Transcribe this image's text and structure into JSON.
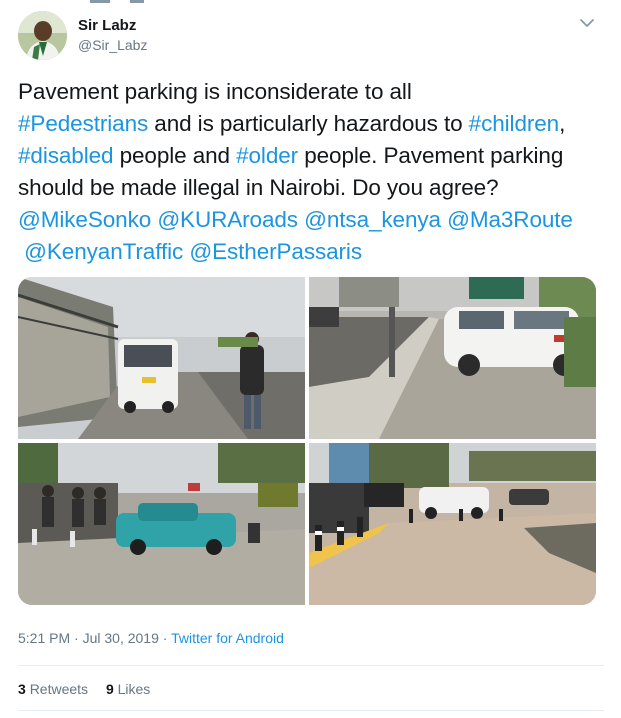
{
  "author": {
    "display_name": "Sir Labz",
    "handle": "@Sir_Labz"
  },
  "tweet": {
    "line1": "Pavement parking is inconsiderate to all",
    "hashtag_pedestrians": "#Pedestrians",
    "line2_mid": " and is particularly hazardous to ",
    "hashtag_children": "#children",
    "line2_end": ",",
    "hashtag_disabled": "#disabled",
    "line3_mid": " people and ",
    "hashtag_older": "#older",
    "line3_end": " people. Pavement parking",
    "line4": "should be made illegal in Nairobi. Do you agree?",
    "mention_mikesonko": "@MikeSonko",
    "mention_kuraroads": "@KURAroads",
    "mention_ntsa": "@ntsa_kenya",
    "mention_ma3route": "@Ma3Route",
    "mention_kenyantraffic": "@KenyanTraffic",
    "mention_estherpassaris": "@EstherPassaris"
  },
  "meta": {
    "timestamp": "5:21 PM · Jul 30, 2019",
    "separator": " · ",
    "source": "Twitter for Android"
  },
  "stats": {
    "retweets_count": "3",
    "retweets_label": "Retweets",
    "likes_count": "9",
    "likes_label": "Likes"
  },
  "colors": {
    "link": "#1b95e0",
    "secondary_text": "#657786",
    "primary_text": "#14171a",
    "divider": "#e6ecf0"
  },
  "icons": {
    "caret": "chevron-down-icon"
  }
}
